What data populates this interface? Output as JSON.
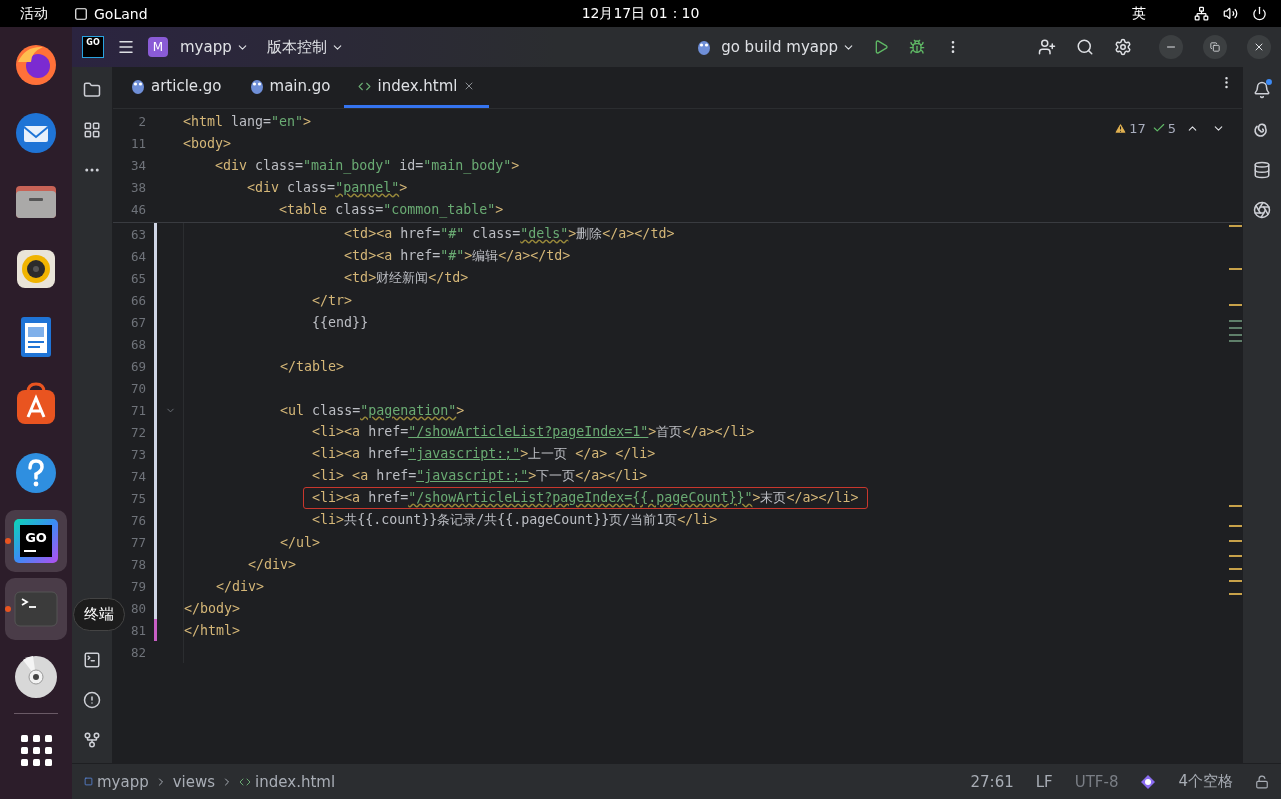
{
  "system_bar": {
    "activities": "活动",
    "app_name": "GoLand",
    "clock": "12月17日  01：10",
    "input_method": "英"
  },
  "dock": [
    {
      "kind": "firefox",
      "running": false
    },
    {
      "kind": "thunderbird",
      "running": false
    },
    {
      "kind": "files",
      "running": false
    },
    {
      "kind": "rhythmbox",
      "running": false
    },
    {
      "kind": "writer",
      "running": false
    },
    {
      "kind": "appcenter",
      "running": false
    },
    {
      "kind": "help",
      "running": false
    },
    {
      "kind": "goland",
      "running": true,
      "logo_text": "GO"
    },
    {
      "kind": "terminal",
      "running": true
    },
    {
      "kind": "disc",
      "running": false
    },
    {
      "kind": "apps",
      "running": false
    }
  ],
  "dock_tooltip": "终端",
  "title_bar": {
    "logo_text": "GO",
    "project_badge": "M",
    "project": "myapp",
    "vcs": "版本控制",
    "run_config": "go build myapp"
  },
  "tabs": [
    {
      "label": "article.go",
      "kind": "go",
      "selected": false
    },
    {
      "label": "main.go",
      "kind": "go",
      "selected": false
    },
    {
      "label": "index.html",
      "kind": "html",
      "selected": true
    }
  ],
  "notifications": {
    "unread": true
  },
  "inspections": {
    "warnings": "17",
    "typos": "5"
  },
  "sticky_lines": [
    {
      "number": "2",
      "tokens": [
        {
          "kind": "tag",
          "text": "<html"
        },
        {
          "kind": "attr",
          "text": " lang="
        },
        {
          "kind": "str",
          "text": "\"en\""
        },
        {
          "kind": "tag",
          "text": ">"
        }
      ]
    },
    {
      "number": "11",
      "tokens": [
        {
          "kind": "tag",
          "text": "<body>"
        }
      ]
    },
    {
      "number": "34",
      "tokens": [
        {
          "kind": "tag",
          "text": "    <div"
        },
        {
          "kind": "attr",
          "text": " class="
        },
        {
          "kind": "str",
          "text": "\"main_body\""
        },
        {
          "kind": "attr",
          "text": " id="
        },
        {
          "kind": "str",
          "text": "\"main_body\""
        },
        {
          "kind": "tag",
          "text": ">"
        }
      ]
    },
    {
      "number": "38",
      "tokens": [
        {
          "kind": "tag",
          "text": "        <div"
        },
        {
          "kind": "attr",
          "text": " class="
        },
        {
          "kind": "warn",
          "text": "\"pannel\""
        },
        {
          "kind": "tag",
          "text": ">"
        }
      ]
    },
    {
      "number": "46",
      "tokens": [
        {
          "kind": "tag",
          "text": "            <table"
        },
        {
          "kind": "attr",
          "text": " class="
        },
        {
          "kind": "str",
          "text": "\"common_table\""
        },
        {
          "kind": "tag",
          "text": ">"
        }
      ]
    }
  ],
  "lines": [
    {
      "number": "63",
      "modified": true,
      "added": false,
      "fold": false,
      "boxed": false,
      "tokens": [
        {
          "kind": "tag",
          "text": "                    <td><a"
        },
        {
          "kind": "attr",
          "text": " href="
        },
        {
          "kind": "str",
          "text": "\"#\""
        },
        {
          "kind": "attr",
          "text": " class="
        },
        {
          "kind": "warn",
          "text": "\"dels\""
        },
        {
          "kind": "tag",
          "text": ">"
        },
        {
          "kind": "text",
          "text": "删除"
        },
        {
          "kind": "tag",
          "text": "</a></td>"
        }
      ]
    },
    {
      "number": "64",
      "modified": true,
      "added": false,
      "fold": false,
      "boxed": false,
      "tokens": [
        {
          "kind": "tag",
          "text": "                    <td><a"
        },
        {
          "kind": "attr",
          "text": " href="
        },
        {
          "kind": "str",
          "text": "\"#\""
        },
        {
          "kind": "tag",
          "text": ">"
        },
        {
          "kind": "text",
          "text": "编辑"
        },
        {
          "kind": "tag",
          "text": "</a></td>"
        }
      ]
    },
    {
      "number": "65",
      "modified": true,
      "added": false,
      "fold": false,
      "boxed": false,
      "tokens": [
        {
          "kind": "tag",
          "text": "                    <td>"
        },
        {
          "kind": "text",
          "text": "财经新闻"
        },
        {
          "kind": "tag",
          "text": "</td>"
        }
      ]
    },
    {
      "number": "66",
      "modified": true,
      "added": false,
      "fold": false,
      "boxed": false,
      "tokens": [
        {
          "kind": "tag",
          "text": "                </tr>"
        }
      ]
    },
    {
      "number": "67",
      "modified": true,
      "added": false,
      "fold": false,
      "boxed": false,
      "tokens": [
        {
          "kind": "text",
          "text": "                {{end}}"
        }
      ]
    },
    {
      "number": "68",
      "modified": true,
      "added": false
    },
    {
      "number": "69",
      "modified": true,
      "added": false,
      "fold": false,
      "boxed": false,
      "tokens": [
        {
          "kind": "tag",
          "text": "            </table>"
        }
      ]
    },
    {
      "number": "70",
      "modified": true,
      "added": false
    },
    {
      "number": "71",
      "modified": true,
      "added": false,
      "fold": true,
      "boxed": false,
      "tokens": [
        {
          "kind": "tag",
          "text": "            <ul"
        },
        {
          "kind": "attr",
          "text": " class="
        },
        {
          "kind": "warn",
          "text": "\"pagenation\""
        },
        {
          "kind": "tag",
          "text": ">"
        }
      ]
    },
    {
      "number": "72",
      "modified": true,
      "added": false,
      "fold": false,
      "boxed": false,
      "tokens": [
        {
          "kind": "tag",
          "text": "                <li><a"
        },
        {
          "kind": "attr",
          "text": " href="
        },
        {
          "kind": "link",
          "text": "\"/showArticleList?pageIndex=1\""
        },
        {
          "kind": "tag",
          "text": ">"
        },
        {
          "kind": "text",
          "text": "首页"
        },
        {
          "kind": "tag",
          "text": "</a></li>"
        }
      ]
    },
    {
      "number": "73",
      "modified": true,
      "added": false,
      "fold": false,
      "boxed": false,
      "tokens": [
        {
          "kind": "tag",
          "text": "                <li><a"
        },
        {
          "kind": "attr",
          "text": " href="
        },
        {
          "kind": "link",
          "text": "\"javascript:;\""
        },
        {
          "kind": "tag",
          "text": ">"
        },
        {
          "kind": "text",
          "text": "上一页 "
        },
        {
          "kind": "tag",
          "text": "</a> </li>"
        }
      ]
    },
    {
      "number": "74",
      "modified": true,
      "added": false,
      "fold": false,
      "boxed": false,
      "tokens": [
        {
          "kind": "tag",
          "text": "                <li> <a"
        },
        {
          "kind": "attr",
          "text": " href="
        },
        {
          "kind": "link",
          "text": "\"javascript:;\""
        },
        {
          "kind": "tag",
          "text": ">"
        },
        {
          "kind": "text",
          "text": "下一页"
        },
        {
          "kind": "tag",
          "text": "</a></li>"
        }
      ]
    },
    {
      "number": "75",
      "modified": true,
      "added": false,
      "fold": false,
      "boxed": true,
      "tokens": [
        {
          "kind": "tag",
          "text": "                <li><a"
        },
        {
          "kind": "attr",
          "text": " href="
        },
        {
          "kind": "warn",
          "text": "\"/showArticleList?pageIndex={{.pageCount}}\""
        },
        {
          "kind": "tag",
          "text": ">"
        },
        {
          "kind": "text",
          "text": "末页"
        },
        {
          "kind": "tag",
          "text": "</a></li>"
        }
      ]
    },
    {
      "number": "76",
      "modified": true,
      "added": false,
      "fold": false,
      "boxed": false,
      "tokens": [
        {
          "kind": "tag",
          "text": "                <li>"
        },
        {
          "kind": "text",
          "text": "共{{.count}}条记录/共{{.pageCount}}页/当前1页"
        },
        {
          "kind": "tag",
          "text": "</li>"
        }
      ]
    },
    {
      "number": "77",
      "modified": true,
      "added": false,
      "fold": false,
      "boxed": false,
      "tokens": [
        {
          "kind": "tag",
          "text": "            </ul>"
        }
      ]
    },
    {
      "number": "78",
      "modified": true,
      "added": false,
      "fold": false,
      "boxed": false,
      "tokens": [
        {
          "kind": "tag",
          "text": "        </div>"
        }
      ]
    },
    {
      "number": "79",
      "modified": true,
      "added": false,
      "fold": false,
      "boxed": false,
      "tokens": [
        {
          "kind": "tag",
          "text": "    </div>"
        }
      ]
    },
    {
      "number": "80",
      "modified": true,
      "added": false,
      "fold": false,
      "boxed": false,
      "tokens": [
        {
          "kind": "tag",
          "text": "</body>"
        }
      ]
    },
    {
      "number": "81",
      "modified": false,
      "added": true,
      "fold": false,
      "boxed": false,
      "tokens": [
        {
          "kind": "tag",
          "text": "</html>"
        }
      ]
    },
    {
      "number": "82"
    }
  ],
  "status_bar": {
    "breadcrumbs": [
      {
        "label": "myapp",
        "kind": "module"
      },
      {
        "label": "views",
        "kind": "folder"
      },
      {
        "label": "index.html",
        "kind": "html"
      }
    ],
    "position": "27:61",
    "line_ending": "LF",
    "encoding": "UTF-8",
    "indent": "4个空格"
  }
}
